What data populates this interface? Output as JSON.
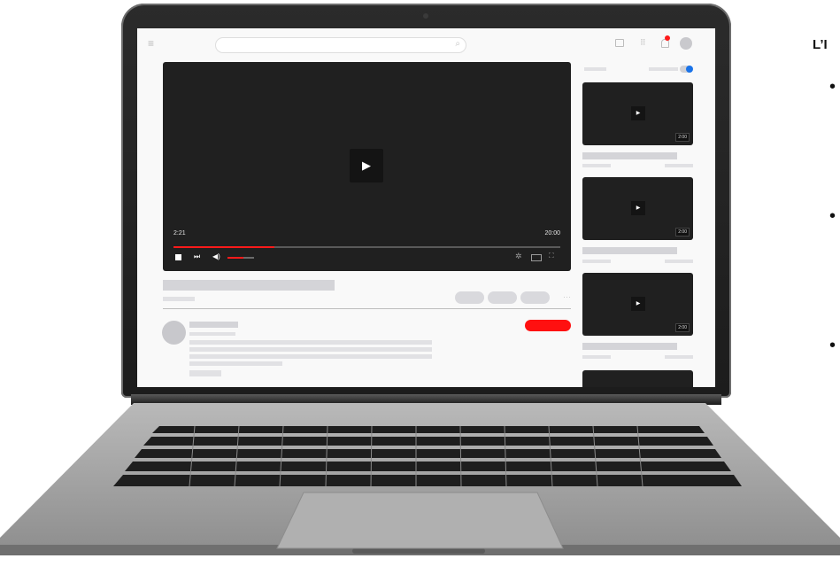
{
  "player": {
    "play_glyph": "▶",
    "time_current": "2:21",
    "time_total": "20:00",
    "progress_fraction": 0.26,
    "volume_fraction": 0.6
  },
  "sidebar": {
    "videos": [
      {
        "duration": "2:00",
        "play_glyph": "▶"
      },
      {
        "duration": "2:00",
        "play_glyph": "▶"
      },
      {
        "duration": "2:00",
        "play_glyph": "▶"
      }
    ]
  },
  "side_text": {
    "heading": "L’I",
    "bullet": "•"
  },
  "colors": {
    "accent_red": "#ff1a1a",
    "toggle_blue": "#1a73e8",
    "player_bg": "#202020"
  },
  "icons": [
    "menu-icon",
    "search-icon",
    "video-camera-icon",
    "apps-grid-icon",
    "bell-icon",
    "avatar",
    "play-icon",
    "stop-icon",
    "skip-next-icon",
    "volume-icon",
    "settings-icon",
    "theater-mode-icon",
    "fullscreen-icon",
    "more-icon"
  ]
}
